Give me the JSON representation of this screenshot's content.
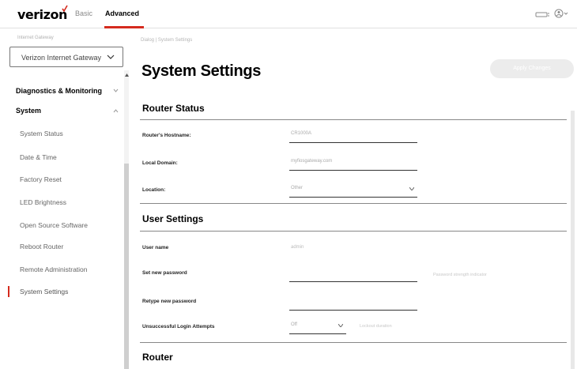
{
  "header": {
    "logo": "verizon",
    "tabs": [
      {
        "label": "Basic",
        "active": false
      },
      {
        "label": "Advanced",
        "active": true
      }
    ],
    "accent_color": "#d52b1e"
  },
  "sidebar": {
    "caption": "Internet Gateway",
    "device_select": "Verizon Internet Gateway",
    "sections": [
      {
        "label": "Diagnostics & Monitoring",
        "expanded": false
      },
      {
        "label": "System",
        "expanded": true
      }
    ],
    "items": [
      {
        "label": "System Status"
      },
      {
        "label": "Date & Time"
      },
      {
        "label": "Factory Reset"
      },
      {
        "label": "LED Brightness"
      },
      {
        "label": "Open Source Software"
      },
      {
        "label": "Reboot Router"
      },
      {
        "label": "Remote Administration"
      },
      {
        "label": "System Settings",
        "active": true
      }
    ]
  },
  "main": {
    "breadcrumb": "Dialog | System Settings",
    "title": "System Settings",
    "apply_label": "Apply Changes",
    "router_status": {
      "title": "Router Status",
      "hostname_label": "Router's Hostname:",
      "hostname_value": "CR1000A",
      "domain_label": "Local Domain:",
      "domain_value": "myfiosgateway.com",
      "location_label": "Location:",
      "location_value": "Other"
    },
    "user_settings": {
      "title": "User Settings",
      "username_label": "User name",
      "username_value": "admin",
      "new_password_label": "Set new password",
      "new_password_hint": "Password strength indicator",
      "retype_password_label": "Retype new password",
      "login_attempts_label": "Unsuccessful Login Attempts",
      "login_attempts_value": "Off",
      "login_attempts_hint": "Lockout duration"
    },
    "router_section": {
      "title": "Router"
    }
  }
}
